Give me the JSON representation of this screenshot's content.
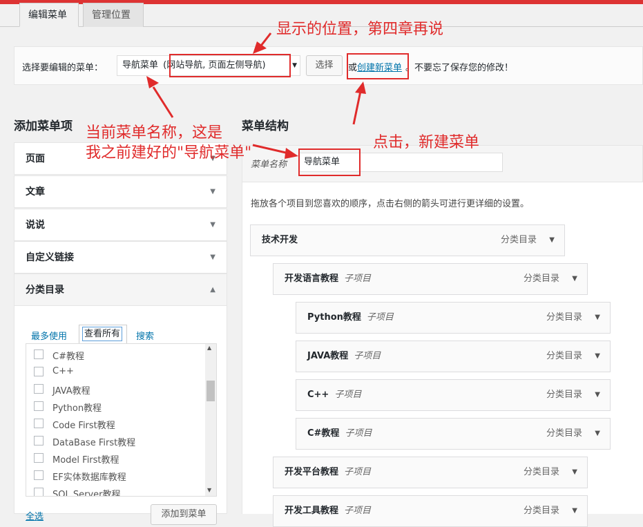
{
  "tabs": [
    {
      "label": "编辑菜单"
    },
    {
      "label": "管理位置"
    }
  ],
  "select_bar": {
    "prompt": "选择要编辑的菜单：",
    "menu_name": "导航菜单",
    "menu_location": "(网站导航, 页面左侧导航)",
    "select_button": "选择",
    "or_text": "或",
    "create_link": "创建新菜单",
    "reminder": "。不要忘了保存您的修改！"
  },
  "left": {
    "heading": "添加菜单项",
    "sections": [
      {
        "label": "页面"
      },
      {
        "label": "文章"
      },
      {
        "label": "说说"
      },
      {
        "label": "自定义链接"
      },
      {
        "label": "分类目录"
      }
    ],
    "subtabs": [
      {
        "label": "最多使用"
      },
      {
        "label": "查看所有"
      },
      {
        "label": "搜索"
      }
    ],
    "categories": [
      "C#教程",
      "C++",
      "JAVA教程",
      "Python教程",
      "Code First教程",
      "DataBase First教程",
      "Model First教程",
      "EF实体数据库教程",
      "SQL Server教程"
    ],
    "select_all": "全选",
    "add_button": "添加到菜单"
  },
  "right": {
    "heading": "菜单结构",
    "name_label": "菜单名称",
    "name_value": "导航菜单",
    "instructions": "拖放各个项目到您喜欢的顺序，点击右侧的箭头可进行更详细的设置。",
    "items": [
      {
        "title": "技术开发",
        "sub": "",
        "type": "分类目录"
      },
      {
        "title": "开发语言教程",
        "sub": "子项目",
        "type": "分类目录"
      },
      {
        "title": "Python教程",
        "sub": "子项目",
        "type": "分类目录"
      },
      {
        "title": "JAVA教程",
        "sub": "子项目",
        "type": "分类目录"
      },
      {
        "title": "C++",
        "sub": "子项目",
        "type": "分类目录"
      },
      {
        "title": "C#教程",
        "sub": "子项目",
        "type": "分类目录"
      },
      {
        "title": "开发平台教程",
        "sub": "子项目",
        "type": "分类目录"
      },
      {
        "title": "开发工具教程",
        "sub": "子项目",
        "type": "分类目录"
      }
    ]
  },
  "annotations": {
    "location_note": "显示的位置，第四章再说",
    "name_note_line1": "当前菜单名称，这是",
    "name_note_line2": "我之前建好的\"导航菜单\"",
    "click_note": "点击，新建菜单",
    "color": "#e02b2b"
  },
  "icons": {
    "dropdown": "▼",
    "collapse": "▲"
  }
}
